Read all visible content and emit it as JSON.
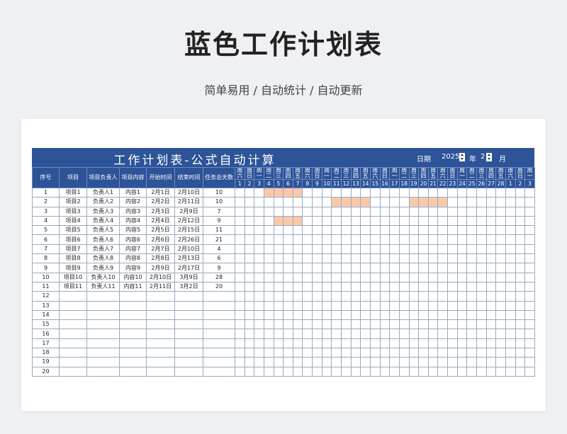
{
  "page": {
    "title": "蓝色工作计划表",
    "subtitle": "简单易用 / 自动统计 / 自动更新"
  },
  "sheet": {
    "title": "工作计划表-公式自动计算",
    "date_label": "日期",
    "year": "2025",
    "year_label": "年",
    "month": "2",
    "month_label": "月",
    "columns": [
      "序号",
      "项目",
      "项目负责人",
      "项目内容",
      "开始时间",
      "结束时间",
      "任务总天数"
    ],
    "weekdays": [
      "周六",
      "周日",
      "周一",
      "周二",
      "周三",
      "周四",
      "周五",
      "周六",
      "周日",
      "周一",
      "周二",
      "周三",
      "周四",
      "周五",
      "周六",
      "周日",
      "周一",
      "周二",
      "周三",
      "周四",
      "周五",
      "周六",
      "周日",
      "周一",
      "周二",
      "周三",
      "周四",
      "周五",
      "周六",
      "周日",
      "周一"
    ],
    "days": [
      "1",
      "2",
      "3",
      "4",
      "5",
      "6",
      "7",
      "8",
      "9",
      "10",
      "11",
      "12",
      "13",
      "14",
      "15",
      "16",
      "17",
      "18",
      "19",
      "20",
      "21",
      "22",
      "23",
      "24",
      "25",
      "26",
      "27",
      "28",
      "1",
      "2",
      "3"
    ],
    "rows": [
      {
        "no": "1",
        "project": "项目1",
        "owner": "负责人1",
        "content": "内容1",
        "start": "2月1日",
        "end": "2月10日",
        "days": "10",
        "bar": [
          3,
          7
        ]
      },
      {
        "no": "2",
        "project": "项目2",
        "owner": "负责人2",
        "content": "内容2",
        "start": "2月2日",
        "end": "2月11日",
        "days": "10",
        "bar": [
          10,
          14,
          18,
          22
        ]
      },
      {
        "no": "3",
        "project": "项目3",
        "owner": "负责人3",
        "content": "内容3",
        "start": "2月3日",
        "end": "2月9日",
        "days": "7",
        "bar": []
      },
      {
        "no": "4",
        "project": "项目4",
        "owner": "负责人4",
        "content": "内容4",
        "start": "2月4日",
        "end": "2月12日",
        "days": "9",
        "bar": [
          4,
          7
        ]
      },
      {
        "no": "5",
        "project": "项目5",
        "owner": "负责人5",
        "content": "内容5",
        "start": "2月5日",
        "end": "2月15日",
        "days": "11",
        "bar": []
      },
      {
        "no": "6",
        "project": "项目6",
        "owner": "负责人6",
        "content": "内容6",
        "start": "2月6日",
        "end": "2月26日",
        "days": "21",
        "bar": []
      },
      {
        "no": "7",
        "project": "项目7",
        "owner": "负责人7",
        "content": "内容7",
        "start": "2月7日",
        "end": "2月10日",
        "days": "4",
        "bar": []
      },
      {
        "no": "8",
        "project": "项目8",
        "owner": "负责人8",
        "content": "内容8",
        "start": "2月8日",
        "end": "2月13日",
        "days": "6",
        "bar": []
      },
      {
        "no": "9",
        "project": "项目9",
        "owner": "负责人9",
        "content": "内容9",
        "start": "2月9日",
        "end": "2月17日",
        "days": "9",
        "bar": []
      },
      {
        "no": "10",
        "project": "项目10",
        "owner": "负责人10",
        "content": "内容10",
        "start": "2月10日",
        "end": "3月9日",
        "days": "28",
        "bar": []
      },
      {
        "no": "11",
        "project": "项目11",
        "owner": "负责人11",
        "content": "内容11",
        "start": "2月11日",
        "end": "3月2日",
        "days": "20",
        "bar": []
      },
      {
        "no": "12",
        "project": "",
        "owner": "",
        "content": "",
        "start": "",
        "end": "",
        "days": "",
        "bar": []
      },
      {
        "no": "13",
        "project": "",
        "owner": "",
        "content": "",
        "start": "",
        "end": "",
        "days": "",
        "bar": []
      },
      {
        "no": "14",
        "project": "",
        "owner": "",
        "content": "",
        "start": "",
        "end": "",
        "days": "",
        "bar": []
      },
      {
        "no": "15",
        "project": "",
        "owner": "",
        "content": "",
        "start": "",
        "end": "",
        "days": "",
        "bar": []
      },
      {
        "no": "16",
        "project": "",
        "owner": "",
        "content": "",
        "start": "",
        "end": "",
        "days": "",
        "bar": []
      },
      {
        "no": "17",
        "project": "",
        "owner": "",
        "content": "",
        "start": "",
        "end": "",
        "days": "",
        "bar": []
      },
      {
        "no": "18",
        "project": "",
        "owner": "",
        "content": "",
        "start": "",
        "end": "",
        "days": "",
        "bar": []
      },
      {
        "no": "19",
        "project": "",
        "owner": "",
        "content": "",
        "start": "",
        "end": "",
        "days": "",
        "bar": []
      },
      {
        "no": "20",
        "project": "",
        "owner": "",
        "content": "",
        "start": "",
        "end": "",
        "days": "",
        "bar": []
      }
    ]
  },
  "colors": {
    "header_blue": "#2d5398",
    "bar_orange": "#f8c9a9"
  }
}
